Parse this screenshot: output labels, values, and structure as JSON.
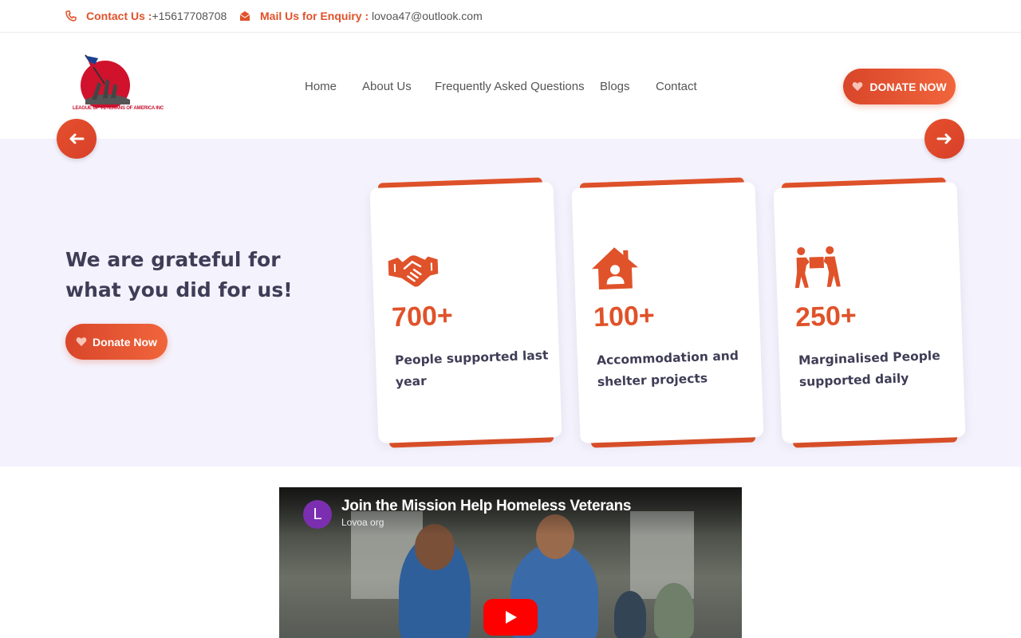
{
  "topbar": {
    "contact_label": "Contact Us :",
    "contact_value": "+15617708708",
    "mail_label": "Mail Us for Enquiry :",
    "mail_value": "lovoa47@outlook.com"
  },
  "header": {
    "logo_text": "LEAGUE OF VETERANS OF AMERICA INC",
    "nav": [
      "Home",
      "About Us",
      "Frequently Asked Questions",
      "Blogs",
      "Contact"
    ],
    "donate_label": "DONATE NOW"
  },
  "hero": {
    "title": "We are grateful for what you did for us!",
    "donate_label": "Donate Now",
    "cards": [
      {
        "icon": "handshake-icon",
        "number": "700+",
        "text": "People supported last year"
      },
      {
        "icon": "home-person-icon",
        "number": "100+",
        "text": "Accommodation and shelter projects"
      },
      {
        "icon": "people-carrying-box-icon",
        "number": "250+",
        "text": "Marginalised People supported daily"
      }
    ]
  },
  "video": {
    "channel_initial": "L",
    "title": "Join the Mission Help Homeless Veterans",
    "channel": "Lovoa org"
  },
  "colors": {
    "accent": "#e0522a",
    "text_dark": "#3f3d56",
    "hero_bg": "#f4f2fd"
  }
}
